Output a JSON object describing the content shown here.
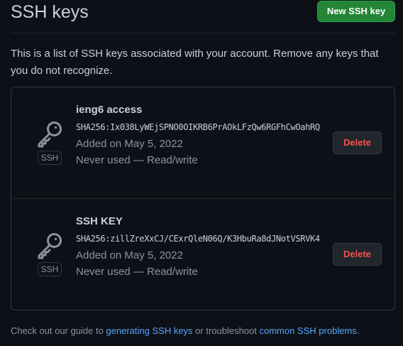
{
  "header": {
    "title": "SSH keys",
    "new_button_label": "New SSH key"
  },
  "intro": "This is a list of SSH keys associated with your account. Remove any keys that you do not recognize.",
  "keys": [
    {
      "name": "ieng6 access",
      "fingerprint": "SHA256:Ix038LyWEjSPNO0OIKRB6PrAOkLFzQw6RGFhCwOahRQ",
      "added": "Added on May 5, 2022",
      "usage": "Never used — Read/write",
      "badge": "SSH",
      "icon": "key-icon",
      "delete_label": "Delete"
    },
    {
      "name": "SSH KEY",
      "fingerprint": "SHA256:zillZreXxCJ/CExrQleN06Q/K3HbuRa8dJNotVSRVK4",
      "added": "Added on May 5, 2022",
      "usage": "Never used — Read/write",
      "badge": "SSH",
      "icon": "key-icon",
      "delete_label": "Delete"
    }
  ],
  "footer": {
    "prefix": "Check out our guide to ",
    "link1": "generating SSH keys",
    "middle": " or troubleshoot ",
    "link2": "common SSH problems",
    "suffix": "."
  },
  "colors": {
    "background": "#0d1117",
    "primary_button": "#238636",
    "danger": "#f85149",
    "link": "#58a6ff",
    "muted": "#8b949e",
    "border": "#30363d"
  }
}
